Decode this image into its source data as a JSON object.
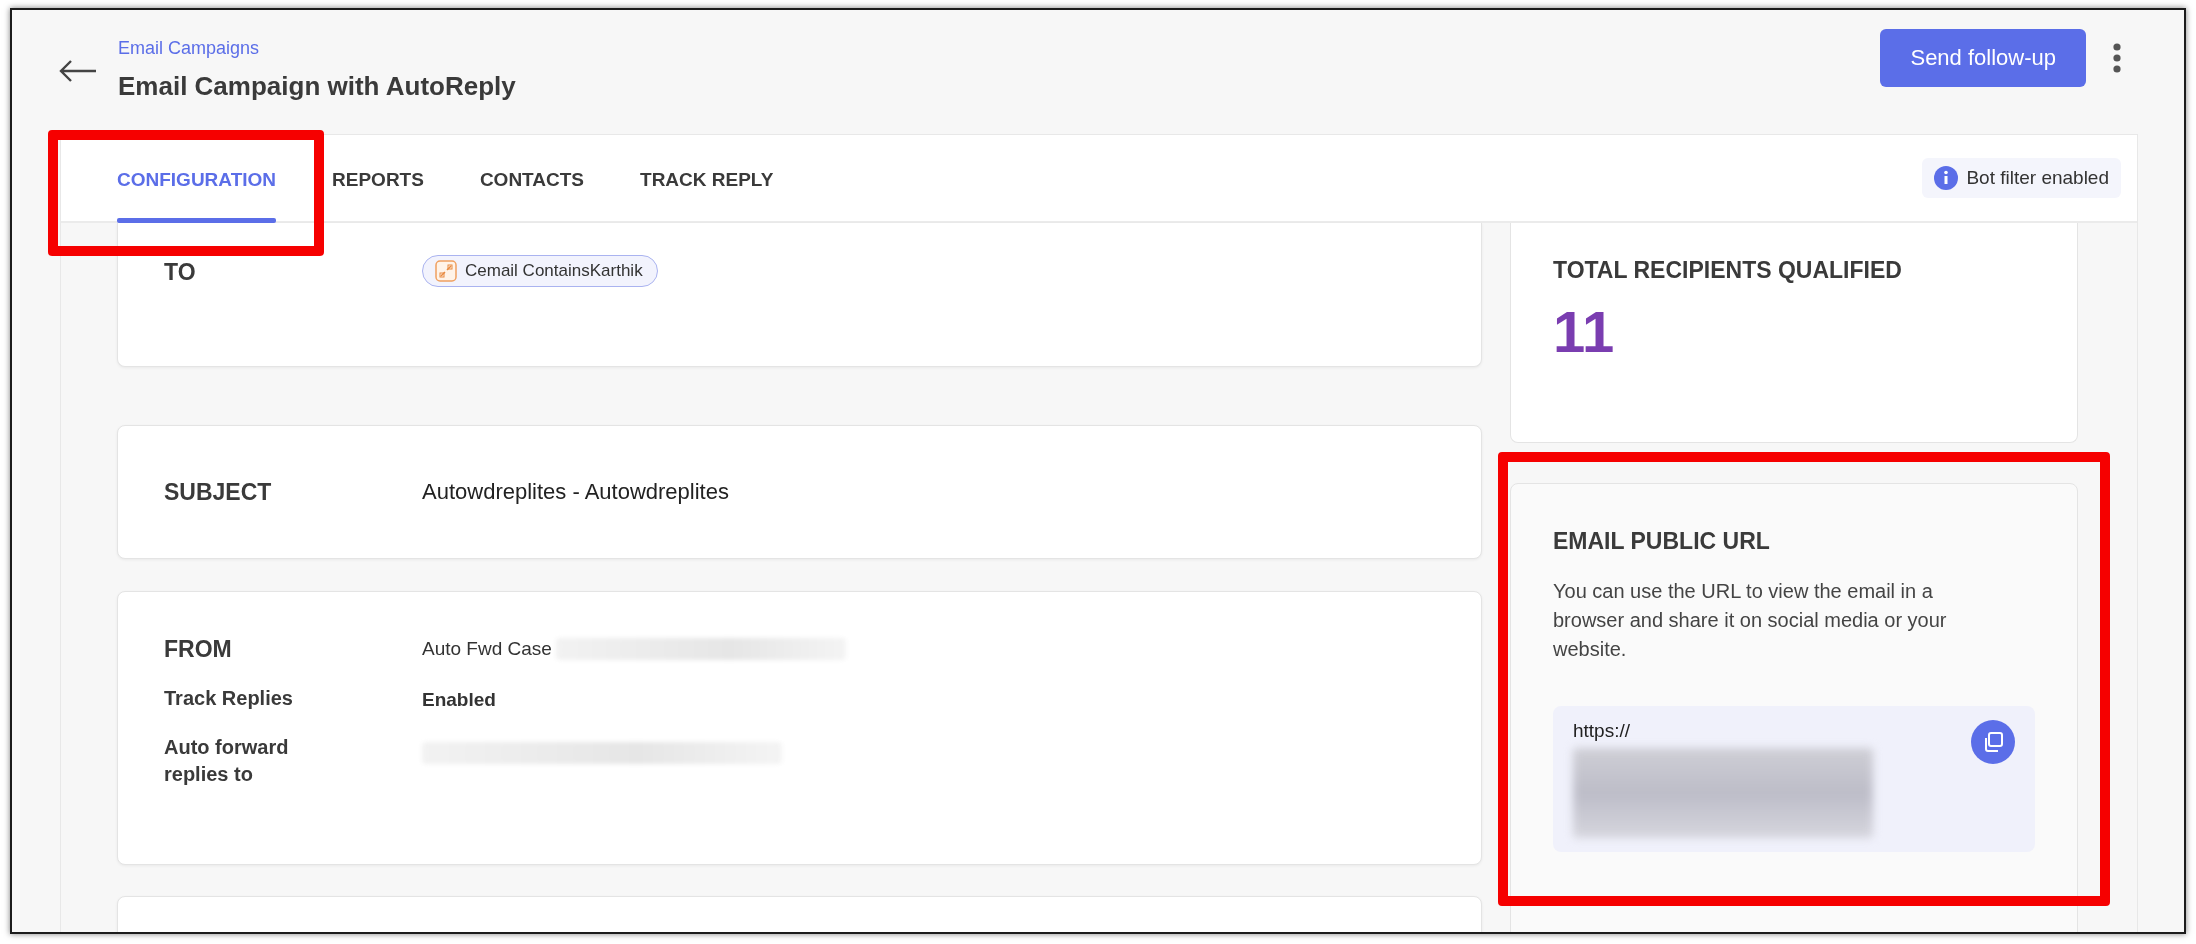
{
  "breadcrumb": "Email Campaigns",
  "title": "Email Campaign with AutoReply",
  "primary_button": "Send follow-up",
  "tabs": [
    {
      "label": "CONFIGURATION",
      "selected": true
    },
    {
      "label": "REPORTS",
      "selected": false
    },
    {
      "label": "CONTACTS",
      "selected": false
    },
    {
      "label": "TRACK REPLY",
      "selected": false
    }
  ],
  "bot_filter": "Bot filter enabled",
  "to": {
    "label": "TO",
    "chips": [
      "Cemail ContainsKarthik"
    ]
  },
  "subject": {
    "label": "SUBJECT",
    "value": "Autowdreplites - Autowdreplites"
  },
  "from": [
    {
      "kind": "heading",
      "label": "FROM",
      "value": "Auto Fwd Case",
      "redacted": true
    },
    {
      "kind": "field",
      "label": "Track Replies",
      "value": "Enabled",
      "redacted": false
    },
    {
      "kind": "field",
      "label": "Auto forward replies to",
      "redacted": true
    }
  ],
  "total": {
    "label": "TOTAL RECIPIENTS QUALIFIED",
    "value": "11"
  },
  "public_url": {
    "title": "EMAIL PUBLIC URL",
    "description": "You can use the URL to view the email in a browser and share it on social media or your website.",
    "url": "https://",
    "redacted": true
  }
}
